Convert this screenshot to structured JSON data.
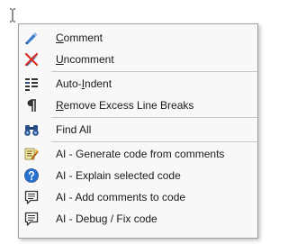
{
  "menu": {
    "items": [
      {
        "id": "comment",
        "pre": "",
        "mn": "C",
        "post": "omment",
        "icon": "pen-comment-icon"
      },
      {
        "id": "uncomment",
        "pre": "",
        "mn": "U",
        "post": "ncomment",
        "icon": "pen-uncomment-icon"
      },
      {
        "id": "auto-indent",
        "pre": "Auto-",
        "mn": "I",
        "post": "ndent",
        "icon": "indent-icon"
      },
      {
        "id": "remove-line-breaks",
        "pre": "",
        "mn": "R",
        "post": "emove Excess Line Breaks",
        "icon": "pilcrow-icon"
      },
      {
        "id": "find-all",
        "pre": "Find All",
        "mn": "",
        "post": "",
        "icon": "binoculars-icon"
      },
      {
        "id": "ai-generate",
        "pre": "AI - Generate code from comments",
        "mn": "",
        "post": "",
        "icon": "code-wand-icon"
      },
      {
        "id": "ai-explain",
        "pre": "AI - Explain selected code",
        "mn": "",
        "post": "",
        "icon": "help-circle-icon"
      },
      {
        "id": "ai-add-comments",
        "pre": "AI - Add comments to code",
        "mn": "",
        "post": "",
        "icon": "speech-bubble-icon"
      },
      {
        "id": "ai-debug",
        "pre": "AI - Debug / Fix code",
        "mn": "",
        "post": "",
        "icon": "speech-bubble-icon"
      }
    ]
  },
  "colors": {
    "menu_bg": "#f8f8f8",
    "border": "#a0a0a0",
    "text": "#1a1a1a"
  }
}
